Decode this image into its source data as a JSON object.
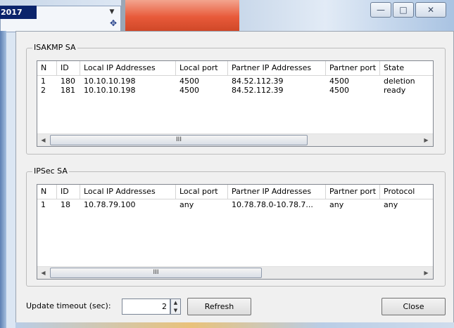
{
  "taskbar": {
    "year_text": "2017",
    "combo_arrow": "▼",
    "move_icon": "✥"
  },
  "window": {
    "buttons": {
      "minimize": "—",
      "maximize": "□",
      "close": "✕"
    }
  },
  "isakmp": {
    "title": "ISAKMP SA",
    "columns": [
      "N",
      "ID",
      "Local IP Addresses",
      "Local port",
      "Partner IP Addresses",
      "Partner port",
      "State"
    ],
    "rows": [
      [
        "1",
        "180",
        "10.10.10.198",
        "4500",
        "84.52.112.39",
        "4500",
        "deletion"
      ],
      [
        "2",
        "181",
        "10.10.10.198",
        "4500",
        "84.52.112.39",
        "4500",
        "ready"
      ]
    ],
    "scroll_left": "◀",
    "scroll_grip": "III",
    "scroll_right": "▶"
  },
  "ipsec": {
    "title": "IPSec SA",
    "columns": [
      "N",
      "ID",
      "Local IP Addresses",
      "Local port",
      "Partner IP Addresses",
      "Partner port",
      "Protocol"
    ],
    "rows": [
      [
        "1",
        "18",
        "10.78.79.100",
        "any",
        "10.78.78.0-10.78.7...",
        "any",
        "any"
      ]
    ],
    "scroll_left": "◀",
    "scroll_grip": "III",
    "scroll_right": "▶"
  },
  "footer": {
    "timeout_label": "Update timeout (sec):",
    "timeout_value": "2",
    "spin_up": "▲",
    "spin_down": "▼",
    "refresh_label": "Refresh",
    "close_label": "Close"
  }
}
